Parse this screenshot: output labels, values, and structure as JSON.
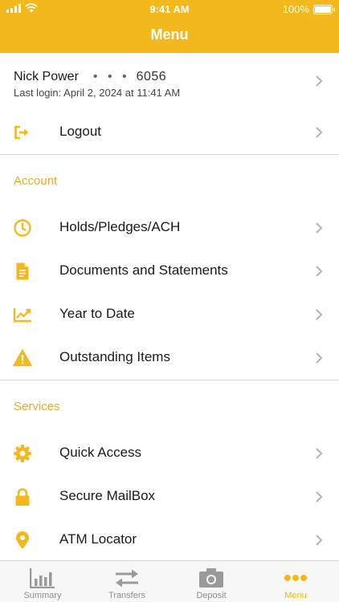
{
  "status_bar": {
    "time": "9:41 AM",
    "battery": "100%"
  },
  "header": {
    "title": "Menu"
  },
  "profile": {
    "name": "Nick Power",
    "masked_dots": "• • •",
    "account_suffix": "6056",
    "last_login": "Last login: April 2, 2024 at 11:41 AM"
  },
  "logout": {
    "label": "Logout",
    "icon": "logout-icon"
  },
  "account_section": {
    "title": "Account",
    "items": [
      {
        "label": "Holds/Pledges/ACH",
        "icon": "clock-icon"
      },
      {
        "label": "Documents and Statements",
        "icon": "document-icon"
      },
      {
        "label": "Year to Date",
        "icon": "trend-chart-icon"
      },
      {
        "label": "Outstanding Items",
        "icon": "warning-icon"
      }
    ]
  },
  "services_section": {
    "title": "Services",
    "items": [
      {
        "label": "Quick Access",
        "icon": "gear-icon"
      },
      {
        "label": "Secure MailBox",
        "icon": "lock-icon"
      },
      {
        "label": "ATM Locator",
        "icon": "location-pin-icon"
      }
    ]
  },
  "tabbar": {
    "tabs": [
      {
        "label": "Summary",
        "icon": "bar-chart-icon",
        "active": false
      },
      {
        "label": "Transfers",
        "icon": "transfer-arrows-icon",
        "active": false
      },
      {
        "label": "Deposit",
        "icon": "camera-icon",
        "active": false
      },
      {
        "label": "Menu",
        "icon": "more-dots-icon",
        "active": true
      }
    ]
  },
  "colors": {
    "accent": "#F3B81D",
    "section_title": "#E9A92A",
    "inactive_tab": "#8e8e8e",
    "chevron": "#b3b3b3"
  }
}
